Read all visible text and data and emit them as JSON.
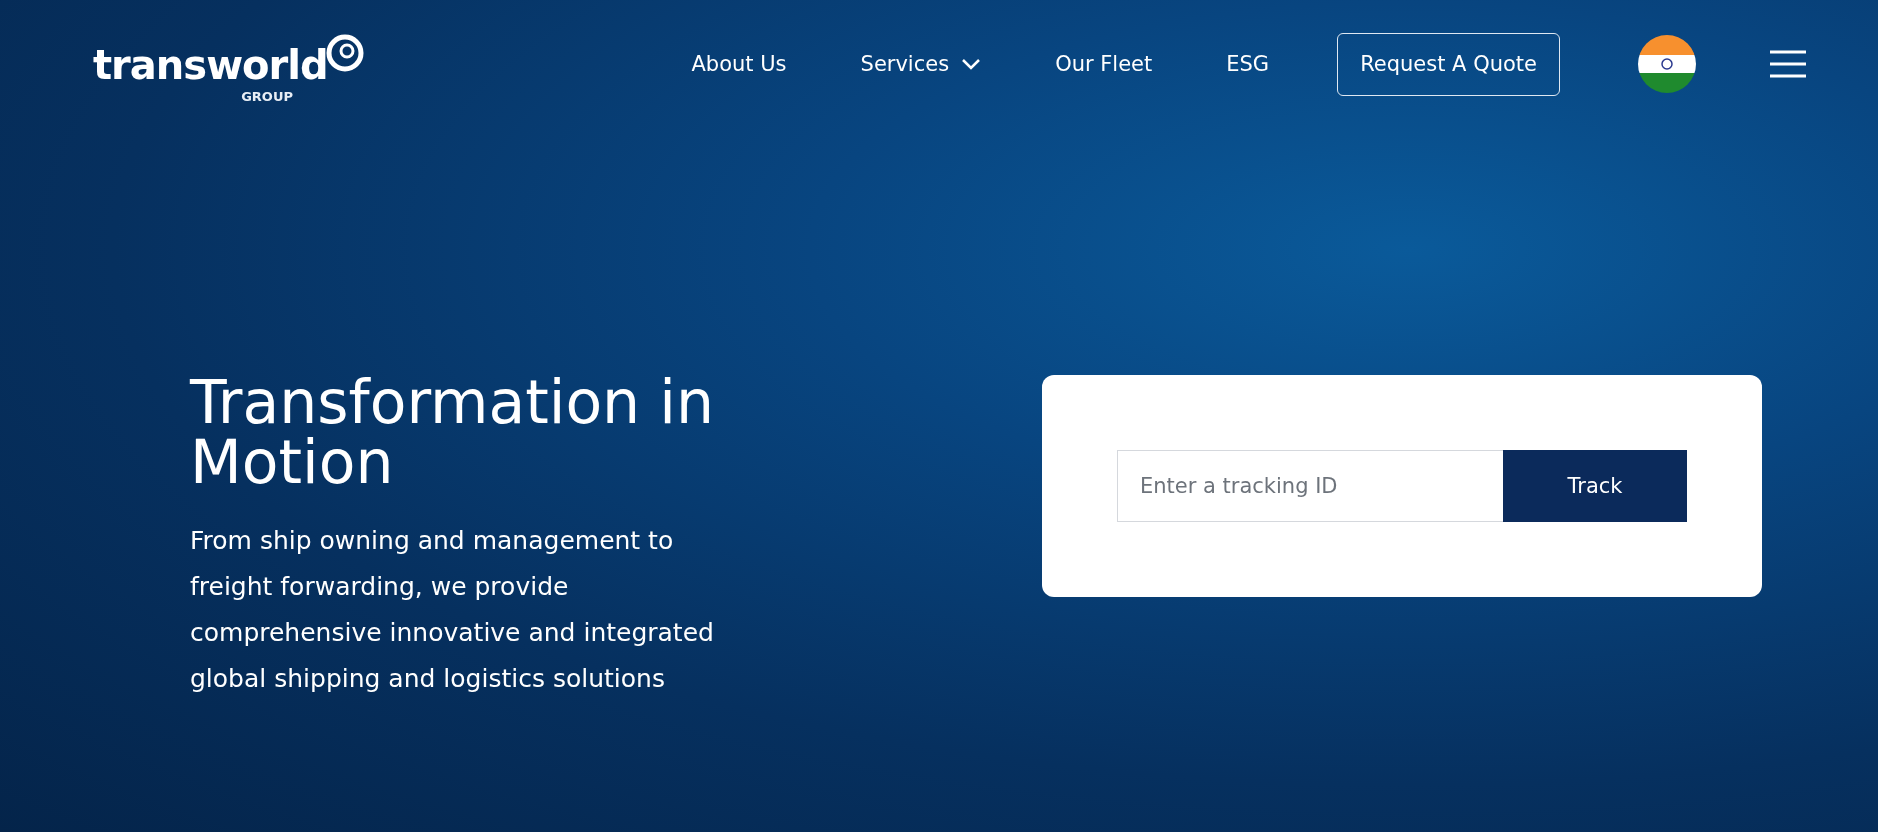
{
  "logo": {
    "wordmark": "transworld",
    "subtitle": "GROUP"
  },
  "nav": [
    {
      "label": "About Us",
      "has_dropdown": false
    },
    {
      "label": "Services",
      "has_dropdown": true
    },
    {
      "label": "Our Fleet",
      "has_dropdown": false
    },
    {
      "label": "ESG",
      "has_dropdown": false
    }
  ],
  "quote_button": "Request A Quote",
  "hero": {
    "title": "Transformation in Motion",
    "text": "From ship owning and management to freight forwarding, we provide comprehensive innovative and integrated global shipping and logistics solutions"
  },
  "tracking": {
    "placeholder": "Enter a tracking ID",
    "button": "Track"
  }
}
